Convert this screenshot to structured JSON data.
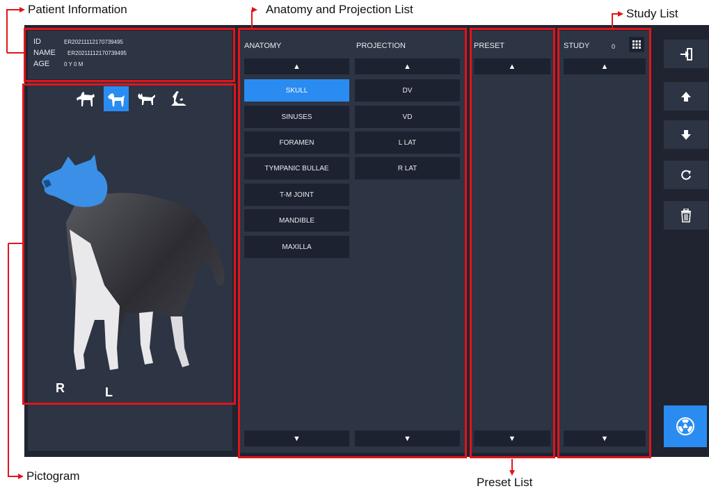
{
  "annotations": {
    "patient_info": "Patient Information",
    "anatomy_projection": "Anatomy and Projection List",
    "study_list": "Study List",
    "pictogram": "Pictogram",
    "preset_list": "Preset List"
  },
  "patient": {
    "id_label": "ID",
    "id_value": "ER20211112170739495",
    "name_label": "NAME",
    "name_value": "ER20211112170739495",
    "age_label": "AGE",
    "age_value": "0 Y 0 M"
  },
  "pictogram": {
    "animals": [
      "horse-icon",
      "dog-icon",
      "cat-icon",
      "bird-icon"
    ],
    "selected_animal": "dog",
    "side_right": "R",
    "side_left": "L",
    "highlight_color": "#2a8cf0"
  },
  "anatomy": {
    "header": "ANATOMY",
    "items": [
      "SKULL",
      "SINUSES",
      "FORAMEN",
      "TYMPANIC BULLAE",
      "T-M JOINT",
      "MANDIBLE",
      "MAXILLA"
    ],
    "selected": "SKULL"
  },
  "projection": {
    "header": "PROJECTION",
    "items": [
      "DV",
      "VD",
      "L LAT",
      "R LAT"
    ]
  },
  "preset": {
    "header": "PRESET"
  },
  "study": {
    "header": "STUDY",
    "count": "0"
  },
  "arrows": {
    "up": "▲",
    "down": "▼"
  },
  "colors": {
    "accent": "#2a8cf0",
    "annotation_red": "#e0151b",
    "background": "#1f2430",
    "panel": "#2d3443"
  }
}
